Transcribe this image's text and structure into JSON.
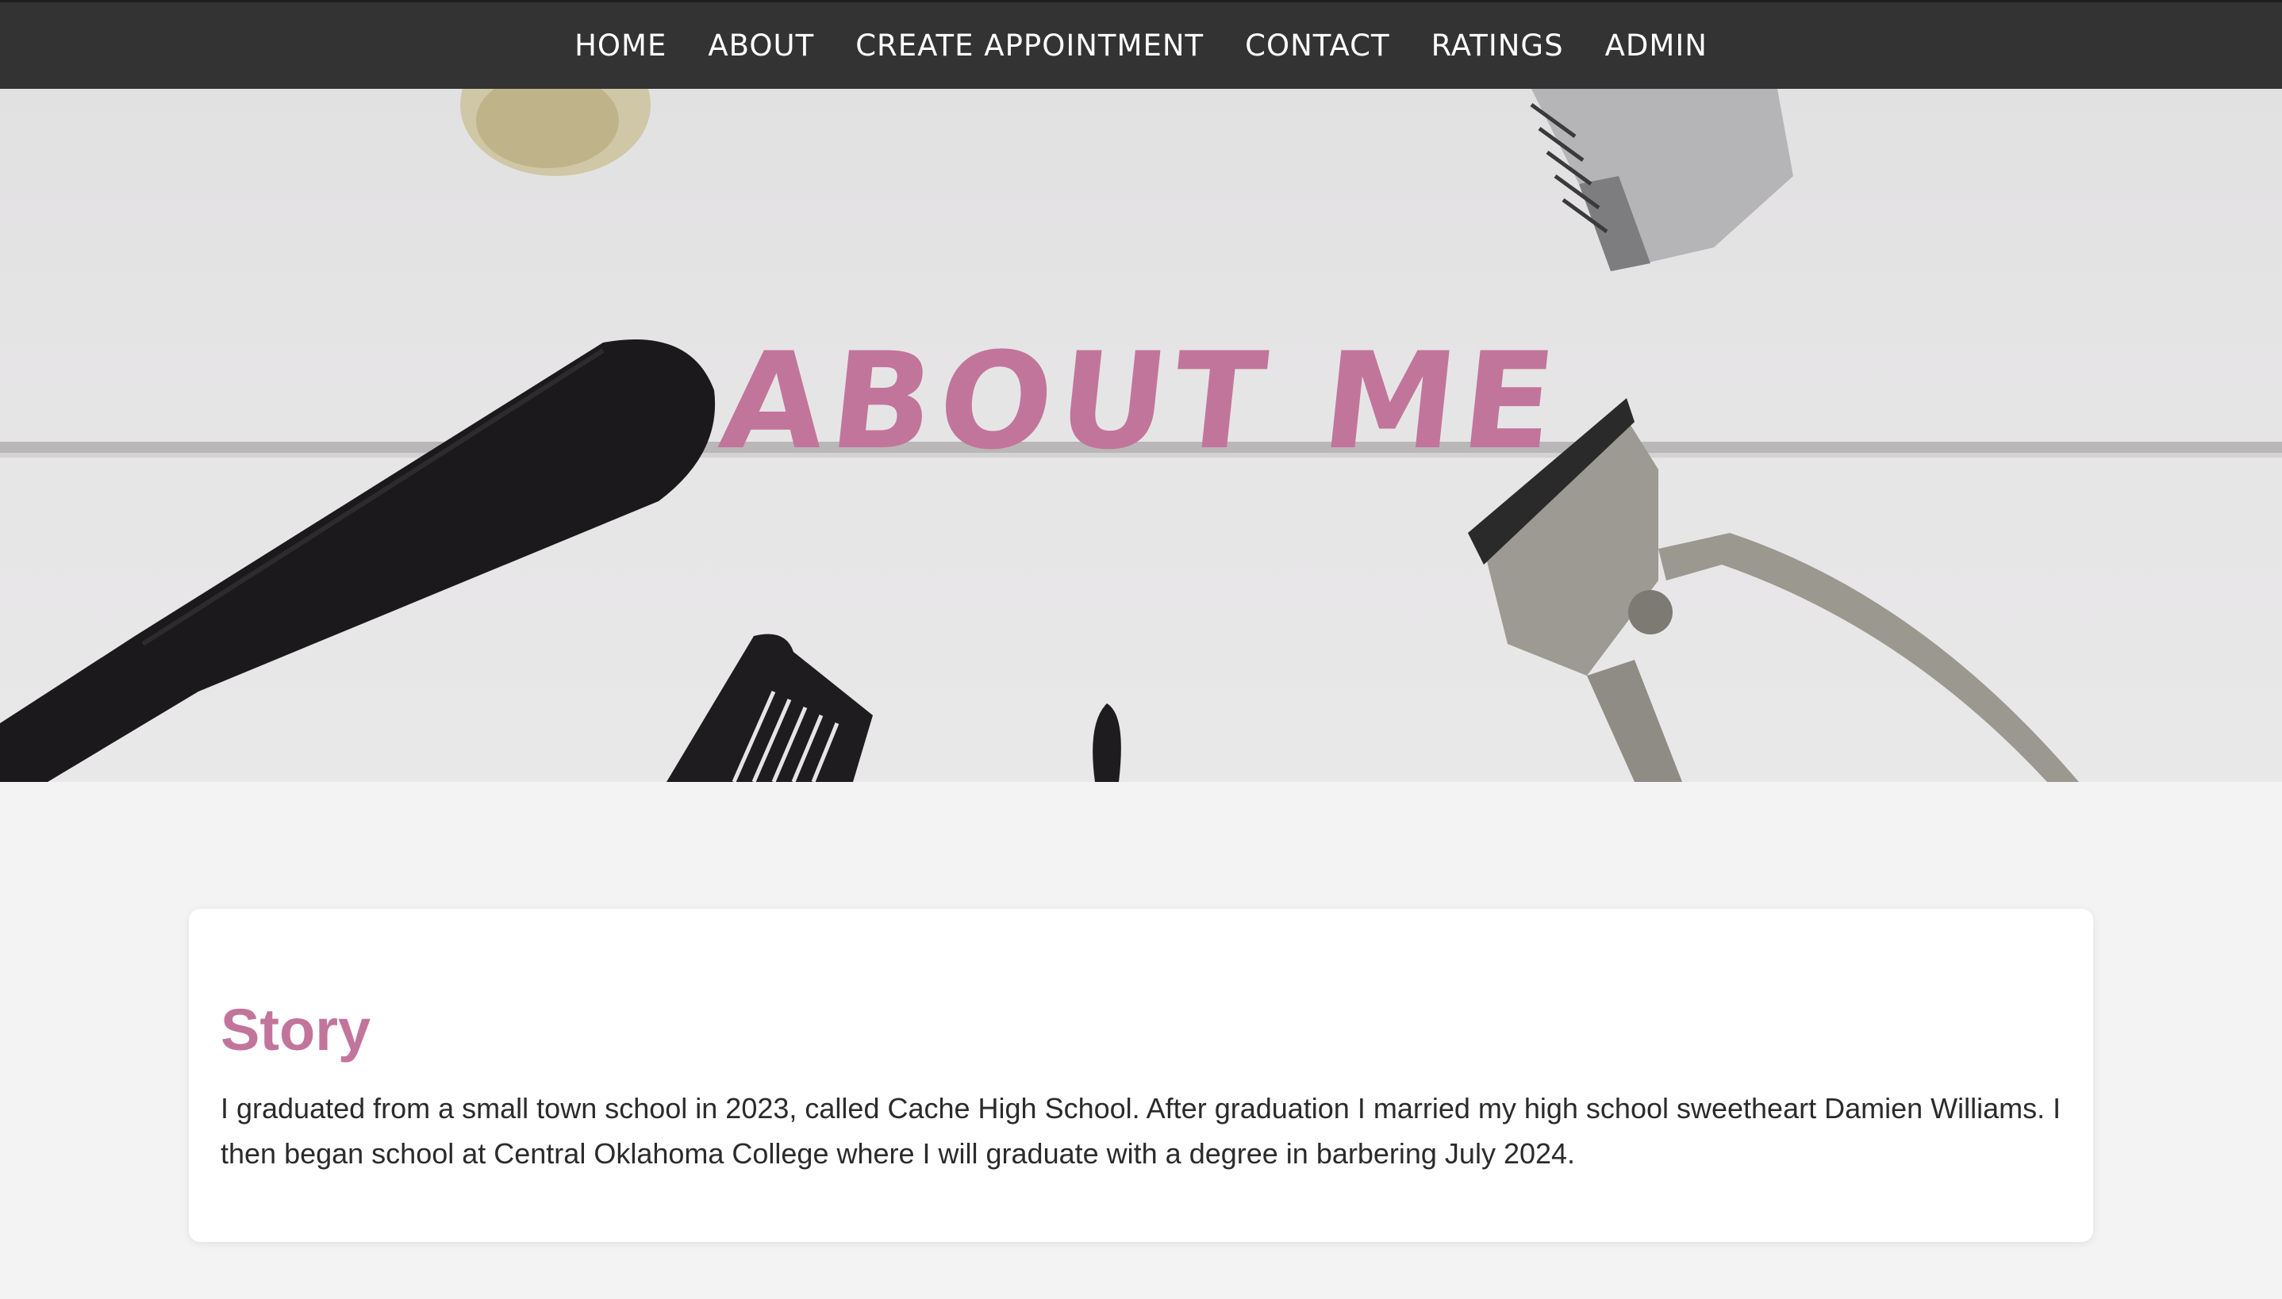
{
  "nav": {
    "items": [
      {
        "label": "HOME"
      },
      {
        "label": "ABOUT"
      },
      {
        "label": "CREATE APPOINTMENT"
      },
      {
        "label": "CONTACT"
      },
      {
        "label": "RATINGS"
      },
      {
        "label": "ADMIN"
      }
    ]
  },
  "hero": {
    "title": "ABOUT ME"
  },
  "story": {
    "heading": "Story",
    "body": "I graduated from a small town school in 2023, called Cache High School. After graduation I married my high school sweetheart Damien Williams. I then began school at Central Oklahoma College where I will graduate with a degree in barbering July 2024."
  },
  "colors": {
    "accent": "#c2759b",
    "nav_background": "#333333",
    "page_background": "#f3f3f3"
  }
}
